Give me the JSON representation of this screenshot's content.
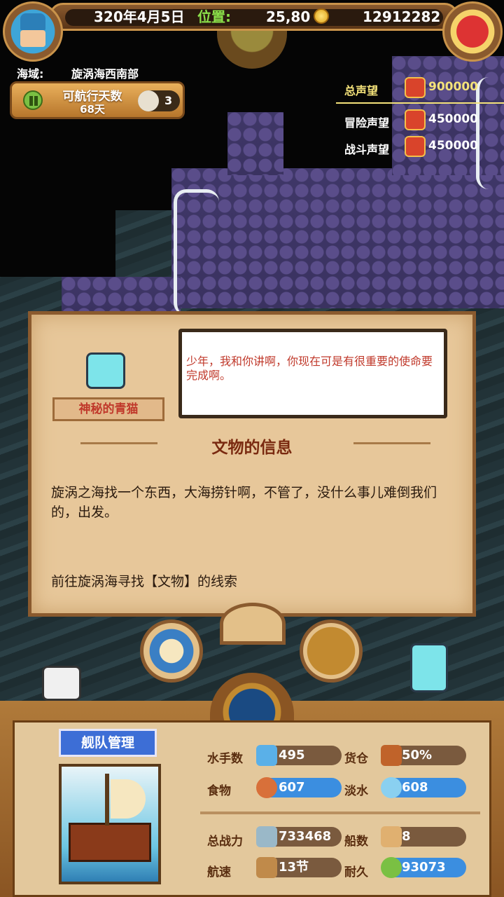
{
  "top": {
    "date": "320年4月5日",
    "position_label": "位置:",
    "position_value": "25,80",
    "gold": "12912282"
  },
  "region": {
    "label": "海域:",
    "name": "旋涡海西南部"
  },
  "sail": {
    "days_label": "可航行天数",
    "days_value": "68天",
    "compass_count": "3"
  },
  "reputation": {
    "total_label": "总声望",
    "total_value": "900000",
    "adventure_label": "冒险声望",
    "adventure_value": "450000",
    "battle_label": "战斗声望",
    "battle_value": "450000"
  },
  "dialog": {
    "speaker": "神秘的青猫",
    "speech": "少年，我和你讲啊，你现在可是有很重要的使命要完成啊。",
    "title": "文物的信息",
    "body": "旋涡之海找一个东西，大海捞针啊，不管了，没什么事儿难倒我们的，出发。",
    "task": "前往旋涡海寻找【文物】的线索"
  },
  "fleet": {
    "title": "舰队管理",
    "sailors_label": "水手数",
    "sailors_value": "495",
    "cargo_label": "货仓",
    "cargo_value": "50%",
    "food_label": "食物",
    "food_value": "607",
    "water_label": "淡水",
    "water_value": "608",
    "power_label": "总战力",
    "power_value": "733468",
    "ships_label": "船数",
    "ships_value": "8",
    "speed_label": "航速",
    "speed_value": "13节",
    "durability_label": "耐久",
    "durability_value": "93073"
  },
  "colors": {
    "accent_gold": "#f4e27a",
    "position_green": "#8be04a",
    "speech_red": "#c0392b"
  }
}
